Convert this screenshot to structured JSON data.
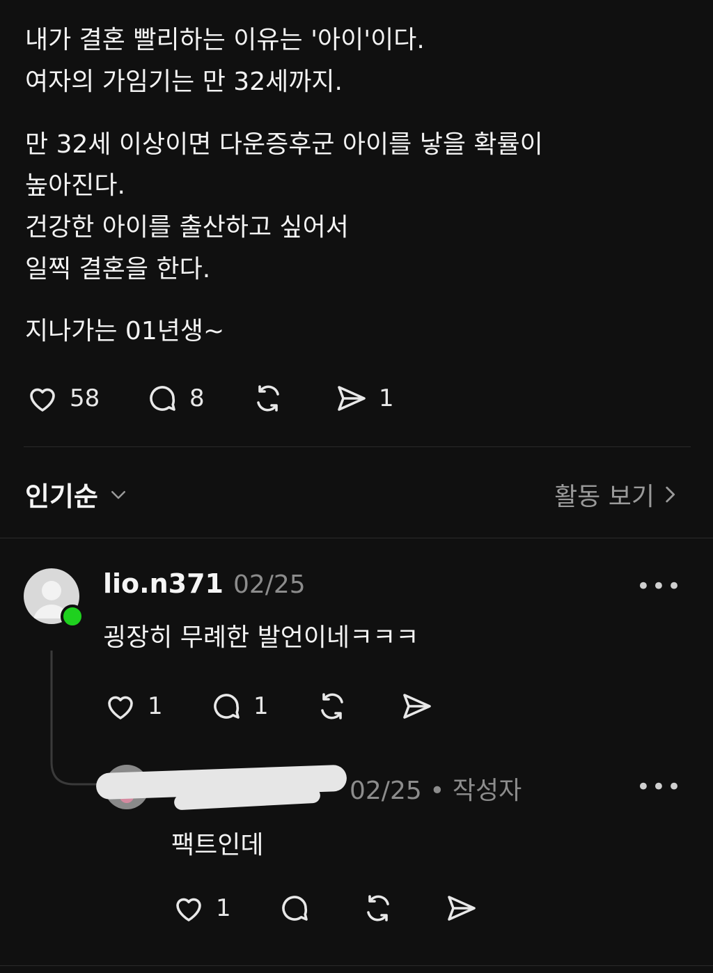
{
  "post": {
    "lines": [
      "내가 결혼 빨리하는 이유는 '아이'이다.",
      "여자의 가임기는 만 32세까지.",
      "만 32세 이상이면 다운증후군 아이를 낳을 확률이",
      "높아진다.",
      "건강한 아이를 출산하고 싶어서",
      "일찍 결혼을 한다.",
      "지나가는 01년생~"
    ],
    "likes": "58",
    "comments": "8",
    "shares": "1"
  },
  "sort": {
    "label": "인기순"
  },
  "activity_link": {
    "label": "활동 보기"
  },
  "comment1": {
    "username": "lio.n371",
    "date": "02/25",
    "text": "굉장히 무례한 발언이네ㅋㅋㅋ",
    "likes": "1",
    "replies": "1",
    "more": "•••"
  },
  "reply1": {
    "meta": "02/25 • 작성자",
    "text": "팩트인데",
    "likes": "1",
    "more": "•••"
  },
  "icons": {
    "like": "heart-icon",
    "comment": "speech-bubble-icon",
    "repost": "repost-icon",
    "share": "send-icon",
    "dropdown": "chevron-down-icon",
    "forward": "chevron-right-icon"
  },
  "colors": {
    "background": "#101010",
    "online": "#1fd11f",
    "muted": "#8c8c8c"
  }
}
